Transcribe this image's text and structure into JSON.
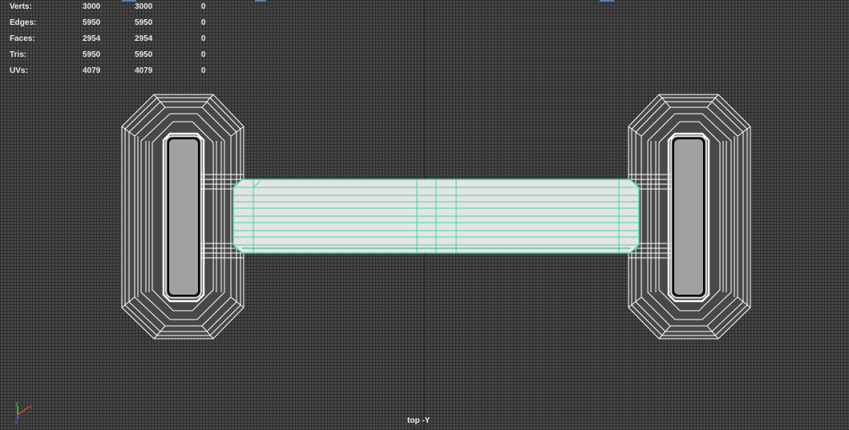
{
  "hud": {
    "rows": [
      {
        "label": "Verts:",
        "c1": "3000",
        "c2": "3000",
        "c3": "0"
      },
      {
        "label": "Edges:",
        "c1": "5950",
        "c2": "5950",
        "c3": "0"
      },
      {
        "label": "Faces:",
        "c1": "2954",
        "c2": "2954",
        "c3": "0"
      },
      {
        "label": "Tris:",
        "c1": "5950",
        "c2": "5950",
        "c3": "0"
      },
      {
        "label": "UVs:",
        "c1": "4079",
        "c2": "4079",
        "c3": "0"
      }
    ]
  },
  "viewport": {
    "camera_label": "top -Y",
    "background_color": "#454545",
    "wireframe_color": "#ffffff",
    "selected_wire_color": "#3fd7a0",
    "selected_fill_color": "#e6e6e6",
    "plate_fill_color": "#a0a0a0"
  },
  "axis_gizmo": {
    "x_label": "x",
    "y_label": "y",
    "z_label": "z"
  }
}
